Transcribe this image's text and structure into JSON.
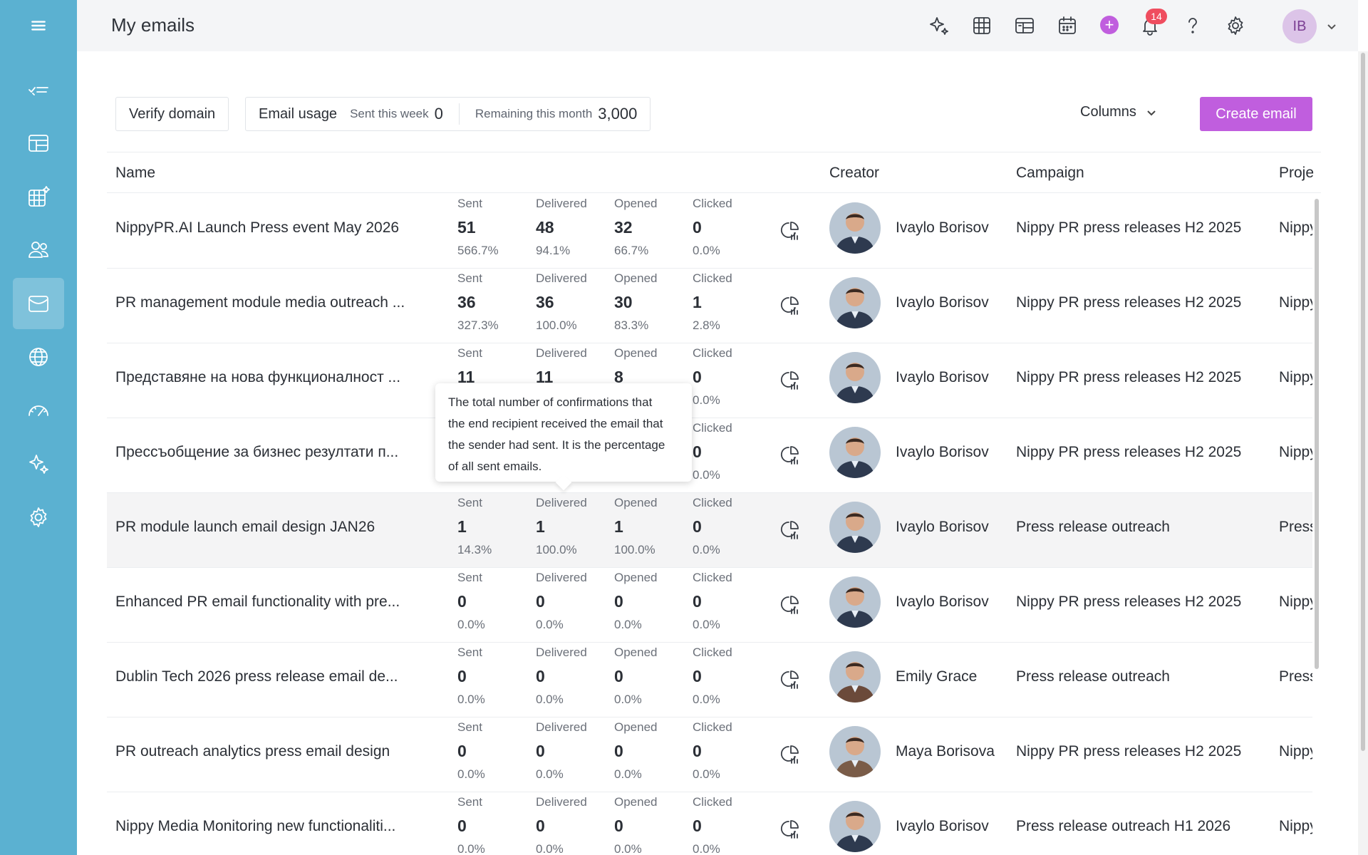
{
  "header": {
    "title": "My emails",
    "avatar_initials": "IB",
    "notification_count": "14",
    "plus": "+"
  },
  "toolbar": {
    "verify_domain": "Verify domain",
    "email_usage": "Email usage",
    "sent_this_week_label": "Sent this week",
    "sent_this_week_value": "0",
    "remaining_label": "Remaining this month",
    "remaining_value": "3,000",
    "columns": "Columns",
    "create_email": "Create email"
  },
  "table": {
    "columns": {
      "name": "Name",
      "creator": "Creator",
      "campaign": "Campaign",
      "project": "Proje"
    },
    "stat_labels": {
      "sent": "Sent",
      "delivered": "Delivered",
      "opened": "Opened",
      "clicked": "Clicked"
    },
    "rows": [
      {
        "name": "NippyPR.AI Launch Press event May 2026",
        "sent": "51",
        "sent_pct": "566.7%",
        "delivered": "48",
        "delivered_pct": "94.1%",
        "opened": "32",
        "opened_pct": "66.7%",
        "clicked": "0",
        "clicked_pct": "0.0%",
        "creator": "Ivaylo Borisov",
        "campaign": "Nippy PR press releases H2 2025",
        "project": "Nippy"
      },
      {
        "name": "PR management module media outreach ...",
        "sent": "36",
        "sent_pct": "327.3%",
        "delivered": "36",
        "delivered_pct": "100.0%",
        "opened": "30",
        "opened_pct": "83.3%",
        "clicked": "1",
        "clicked_pct": "2.8%",
        "creator": "Ivaylo Borisov",
        "campaign": "Nippy PR press releases H2 2025",
        "project": "Nippy"
      },
      {
        "name": "Представяне на нова функционалност ...",
        "sent": "11",
        "sent_pct": "",
        "delivered": "11",
        "delivered_pct": "",
        "opened": "8",
        "opened_pct": "",
        "clicked": "0",
        "clicked_pct": "0.0%",
        "creator": "Ivaylo Borisov",
        "campaign": "Nippy PR press releases H2 2025",
        "project": "Nippy"
      },
      {
        "name": "Прессъобщение за бизнес резултати п...",
        "sent": "",
        "sent_pct": "",
        "delivered": "",
        "delivered_pct": "",
        "opened": "",
        "opened_pct": "",
        "clicked": "0",
        "clicked_pct": "0.0%",
        "creator": "Ivaylo Borisov",
        "campaign": "Nippy PR press releases H2 2025",
        "project": "Nippy"
      },
      {
        "name": "PR module launch email design JAN26",
        "sent": "1",
        "sent_pct": "14.3%",
        "delivered": "1",
        "delivered_pct": "100.0%",
        "opened": "1",
        "opened_pct": "100.0%",
        "clicked": "0",
        "clicked_pct": "0.0%",
        "creator": "Ivaylo Borisov",
        "campaign": "Press release outreach",
        "project": "Press"
      },
      {
        "name": "Enhanced PR email functionality with pre...",
        "sent": "0",
        "sent_pct": "0.0%",
        "delivered": "0",
        "delivered_pct": "0.0%",
        "opened": "0",
        "opened_pct": "0.0%",
        "clicked": "0",
        "clicked_pct": "0.0%",
        "creator": "Ivaylo Borisov",
        "campaign": "Nippy PR press releases H2 2025",
        "project": "Nippy"
      },
      {
        "name": "Dublin Tech 2026 press release email de...",
        "sent": "0",
        "sent_pct": "0.0%",
        "delivered": "0",
        "delivered_pct": "0.0%",
        "opened": "0",
        "opened_pct": "0.0%",
        "clicked": "0",
        "clicked_pct": "0.0%",
        "creator": "Emily Grace",
        "campaign": "Press release outreach",
        "project": "Press"
      },
      {
        "name": "PR outreach analytics press email design",
        "sent": "0",
        "sent_pct": "0.0%",
        "delivered": "0",
        "delivered_pct": "0.0%",
        "opened": "0",
        "opened_pct": "0.0%",
        "clicked": "0",
        "clicked_pct": "0.0%",
        "creator": "Maya Borisova",
        "campaign": "Nippy PR press releases H2 2025",
        "project": "Nippy"
      },
      {
        "name": "Nippy Media Monitoring new functionaliti...",
        "sent": "0",
        "sent_pct": "0.0%",
        "delivered": "0",
        "delivered_pct": "0.0%",
        "opened": "0",
        "opened_pct": "0.0%",
        "clicked": "0",
        "clicked_pct": "0.0%",
        "creator": "Ivaylo Borisov",
        "campaign": "Press release outreach H1 2026",
        "project": "Nippy"
      }
    ]
  },
  "tooltip": {
    "line1": "The total number of confirmations that",
    "line2": "the end recipient received the email that",
    "line3": "the sender had sent. It is the percentage",
    "line4": "of all sent emails."
  },
  "colors": {
    "sidebar": "#5bb1d1",
    "accent": "#c05ede",
    "badge": "#ef4d5f"
  }
}
